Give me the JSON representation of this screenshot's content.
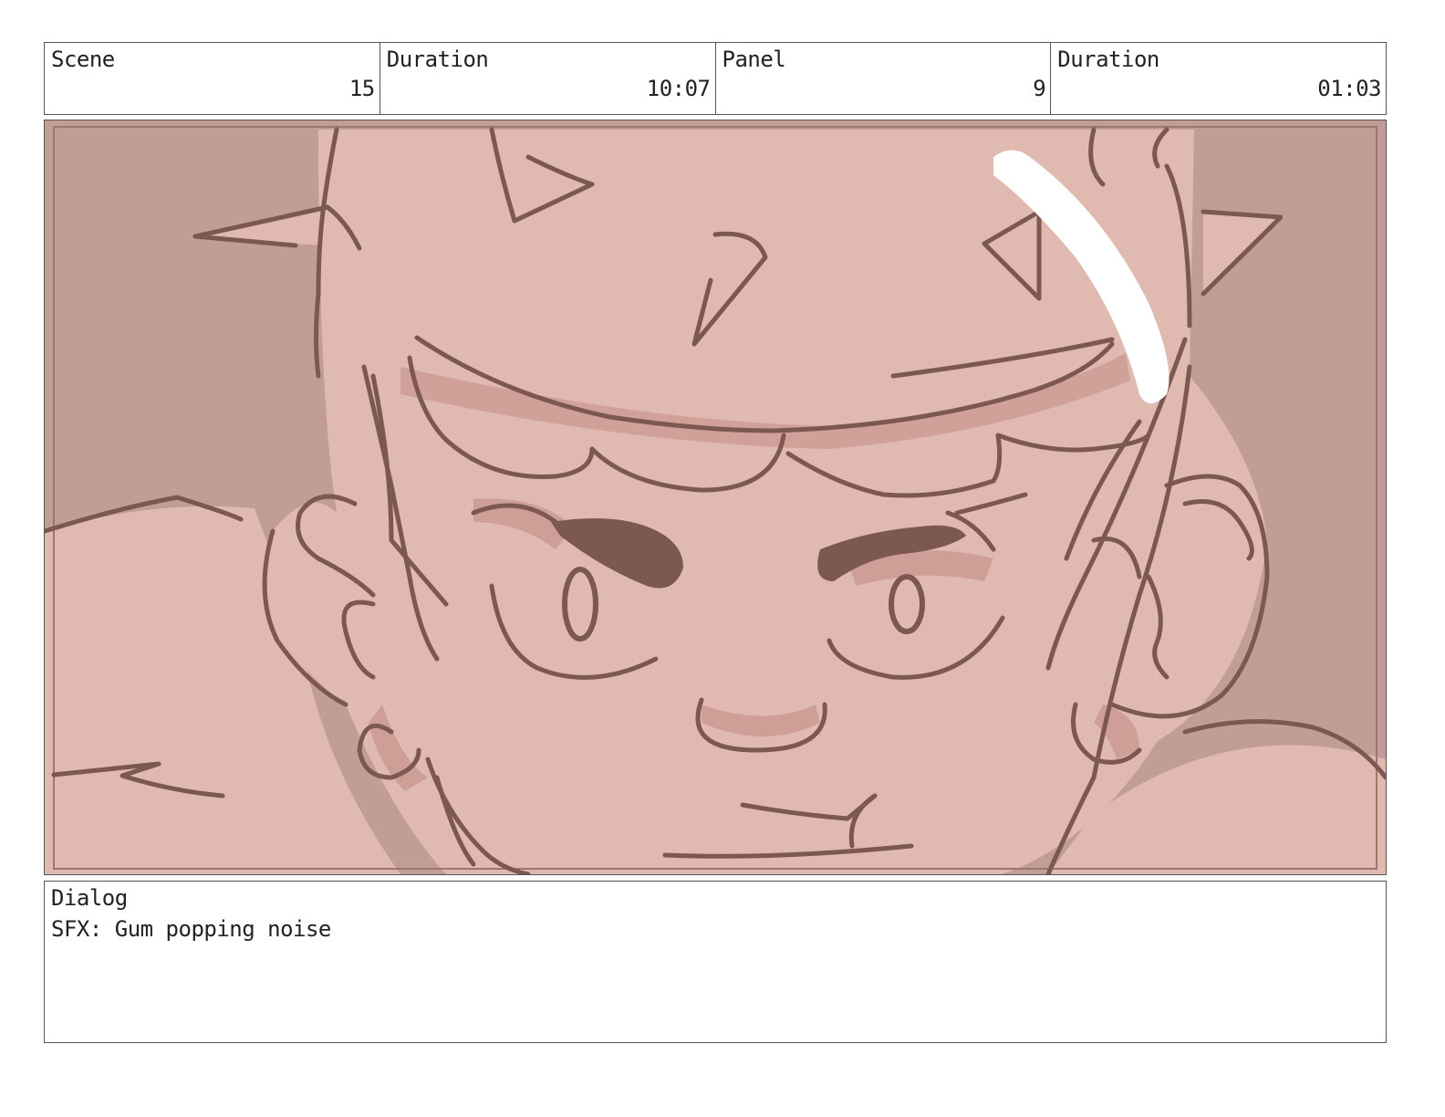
{
  "header": {
    "scene_label": "Scene",
    "scene_value": "15",
    "scene_duration_label": "Duration",
    "scene_duration_value": "10:07",
    "panel_label": "Panel",
    "panel_value": "9",
    "panel_duration_label": "Duration",
    "panel_duration_value": "01:03"
  },
  "dialog": {
    "label": "Dialog",
    "text": "SFX: Gum popping noise"
  },
  "colors": {
    "background_dark": "#c29d95",
    "skin": "#e0b9b1",
    "shadow": "#cd9f96",
    "line": "#7c5850",
    "highlight": "#ffffff"
  }
}
